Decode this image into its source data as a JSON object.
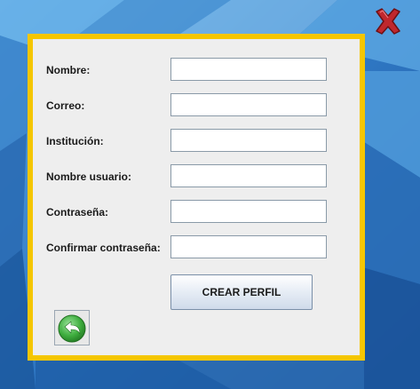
{
  "form": {
    "fields": [
      {
        "label": "Nombre:",
        "value": ""
      },
      {
        "label": "Correo:",
        "value": ""
      },
      {
        "label": "Institución:",
        "value": ""
      },
      {
        "label": "Nombre usuario:",
        "value": ""
      },
      {
        "label": "Contraseña:",
        "value": ""
      },
      {
        "label": "Confirmar contraseña:",
        "value": ""
      }
    ],
    "create_button_label": "CREAR PERFIL"
  },
  "icons": {
    "close": "close-icon",
    "back": "back-arrow-icon"
  },
  "colors": {
    "panel_border": "#f5c600",
    "panel_background": "#eeeeee",
    "close_red": "#c0272d",
    "back_green": "#3fae3f"
  }
}
